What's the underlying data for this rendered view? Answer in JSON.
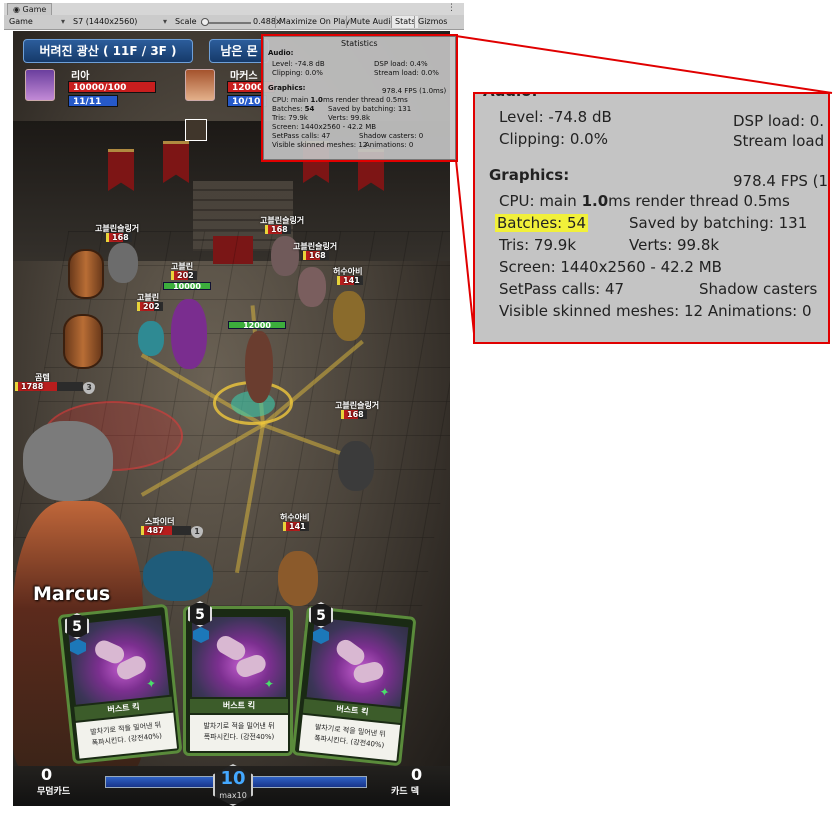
{
  "editor": {
    "tab_label": "Game",
    "menu_icon": "kebab-menu-icon",
    "display_dropdown": "Game",
    "resolution_dropdown": "S7 (1440x2560)",
    "scale_label": "Scale",
    "scale_value": "0.488x",
    "toggles": [
      "Maximize On Play",
      "Mute Audio",
      "Stats",
      "Gizmos"
    ],
    "active_toggle": "Stats"
  },
  "game": {
    "stage_button": "버려진 광산 ( 11F / 3F )",
    "right_button": "남은 몬",
    "hero1": {
      "name": "리아",
      "hp": "10000/100",
      "mp": "11/11"
    },
    "hero2": {
      "name": "마커스",
      "hp": "12000",
      "mp": "10/10"
    },
    "units": [
      {
        "label": "고블린슬링거",
        "hp": "168"
      },
      {
        "label": "고블린슬링거",
        "hp": "168"
      },
      {
        "label": "고블린슬링거",
        "hp": "168"
      },
      {
        "label": "고블린",
        "hp": "202"
      },
      {
        "label": "고블린",
        "hp": "202"
      },
      {
        "label": "허수아비",
        "hp": "141"
      },
      {
        "label": "곰렙",
        "hp": "1788"
      },
      {
        "label": "고블린슬링거",
        "hp": "168"
      },
      {
        "label": "스파이더",
        "hp": "487"
      },
      {
        "label": "허수아비",
        "hp": "141"
      }
    ],
    "green_bars": [
      "10000",
      "12000"
    ],
    "shield_badges": [
      "3",
      "1"
    ],
    "hero_caption": "Marcus",
    "cards": [
      {
        "cost": "5",
        "title": "버스트 킥",
        "desc_line1": "발차기로 적을 밀어낸 뒤",
        "desc_line2": "폭파시킨다. (강전40%)"
      },
      {
        "cost": "5",
        "title": "버스트 킥",
        "desc_line1": "발차기로 적을 밀어낸 뒤",
        "desc_line2": "폭파시킨다. (강전40%)"
      },
      {
        "cost": "5",
        "title": "버스트 킥",
        "desc_line1": "발차기로 적을 밀어낸 뒤",
        "desc_line2": "폭파시킨다. (강전40%)"
      }
    ],
    "discard_count": "0",
    "discard_label": "무덤카드",
    "deck_count": "0",
    "deck_label": "카드 덱",
    "mana": "10",
    "mana_max": "max10"
  },
  "stats": {
    "title": "Statistics",
    "audio_header": "Audio:",
    "level": "Level: -74.8 dB",
    "dsp": "DSP load: 0.4%",
    "clipping": "Clipping: 0.0%",
    "stream": "Stream load: 0.0%",
    "graphics_header": "Graphics:",
    "fps": "978.4 FPS (1.0ms)",
    "cpu_prefix": "CPU: main ",
    "cpu_main": "1.0",
    "cpu_suffix": "ms  render thread 0.5ms",
    "batches_label": "Batches: ",
    "batches_value": "54",
    "saved": "Saved by batching: 131",
    "tris": "Tris: 79.9k",
    "verts": "Verts: 99.8k",
    "screen": "Screen: 1440x2560 - 42.2 MB",
    "setpass": "SetPass calls: 47",
    "shadow": "Shadow casters: 0",
    "skinned": "Visible skinned meshes: 12",
    "animations": "Animations: 0"
  },
  "zoom": {
    "audio_partial": "Audio:",
    "level": "Level: -74.8 dB",
    "dsp": "DSP load: 0.",
    "clipping": "Clipping: 0.0%",
    "stream": "Stream load",
    "graphics_header": "Graphics:",
    "fps": "978.4 FPS (1",
    "cpu_prefix": "CPU: main ",
    "cpu_main": "1.0",
    "cpu_suffix": "ms  render thread 0.5ms",
    "batches": "Batches: 54",
    "saved": "Saved by batching: 131",
    "tris": "Tris: 79.9k",
    "verts": "Verts: 99.8k",
    "screen": "Screen: 1440x2560 - 42.2 MB",
    "setpass": "SetPass calls: 47",
    "shadow": "Shadow casters",
    "skinned": "Visible skinned meshes: 12  Animations: 0",
    "highlight_color": "#f1f03a",
    "callout_color": "#e00000"
  }
}
